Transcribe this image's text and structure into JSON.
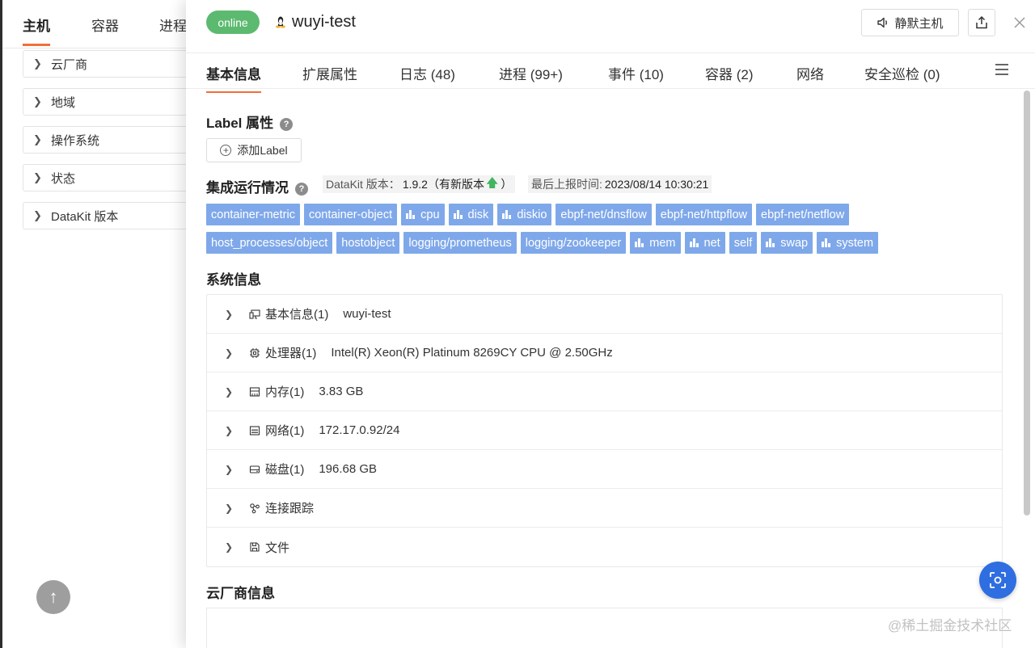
{
  "bg": {
    "tabs": [
      "主机",
      "容器",
      "进程"
    ],
    "filters": [
      "云厂商",
      "地域",
      "操作系统",
      "状态",
      "DataKit 版本"
    ]
  },
  "header": {
    "status": "online",
    "os_icon": "linux-tux-icon",
    "host_name": "wuyi-test",
    "mute_label": "静默主机"
  },
  "tabs": [
    "基本信息",
    "扩展属性",
    "日志 (48)",
    "进程 (99+)",
    "事件 (10)",
    "容器 (2)",
    "网络",
    "安全巡检 (0)"
  ],
  "label_section": {
    "title": "Label 属性",
    "add_label": "添加Label"
  },
  "integration": {
    "title": "集成运行情况",
    "version_label": "DataKit 版本：",
    "version_value": "1.9.2（有新版本",
    "version_suffix": "）",
    "report_label": "最后上报时间:",
    "report_value": "2023/08/14 10:30:21",
    "chips_row1": [
      {
        "text": "container-metric",
        "icon": false
      },
      {
        "text": "container-object",
        "icon": false
      },
      {
        "text": "cpu",
        "icon": true
      },
      {
        "text": "disk",
        "icon": true
      },
      {
        "text": "diskio",
        "icon": true
      },
      {
        "text": "ebpf-net/dnsflow",
        "icon": false
      },
      {
        "text": "ebpf-net/httpflow",
        "icon": false
      },
      {
        "text": "ebpf-net/netflow",
        "icon": false
      }
    ],
    "chips_row2": [
      {
        "text": "host_processes/object",
        "icon": false
      },
      {
        "text": "hostobject",
        "icon": false
      },
      {
        "text": "logging/prometheus",
        "icon": false
      },
      {
        "text": "logging/zookeeper",
        "icon": false
      },
      {
        "text": "mem",
        "icon": true
      },
      {
        "text": "net",
        "icon": true
      },
      {
        "text": "self",
        "icon": false
      },
      {
        "text": "swap",
        "icon": true
      },
      {
        "text": "system",
        "icon": true
      }
    ]
  },
  "system": {
    "title": "系统信息",
    "rows": [
      {
        "icon": "monitor-icon",
        "label": "基本信息(1)",
        "value": "wuyi-test"
      },
      {
        "icon": "cpu-chip-icon",
        "label": "处理器(1)",
        "value": "Intel(R) Xeon(R) Platinum 8269CY CPU @ 2.50GHz"
      },
      {
        "icon": "memory-icon",
        "label": "内存(1)",
        "value": "3.83 GB"
      },
      {
        "icon": "network-icon",
        "label": "网络(1)",
        "value": "172.17.0.92/24"
      },
      {
        "icon": "disk-icon",
        "label": "磁盘(1)",
        "value": "196.68 GB"
      },
      {
        "icon": "connection-trace-icon",
        "label": "连接跟踪",
        "value": ""
      },
      {
        "icon": "file-icon",
        "label": "文件",
        "value": ""
      }
    ]
  },
  "cloud": {
    "title": "云厂商信息"
  },
  "watermark": "@稀土掘金技术社区"
}
